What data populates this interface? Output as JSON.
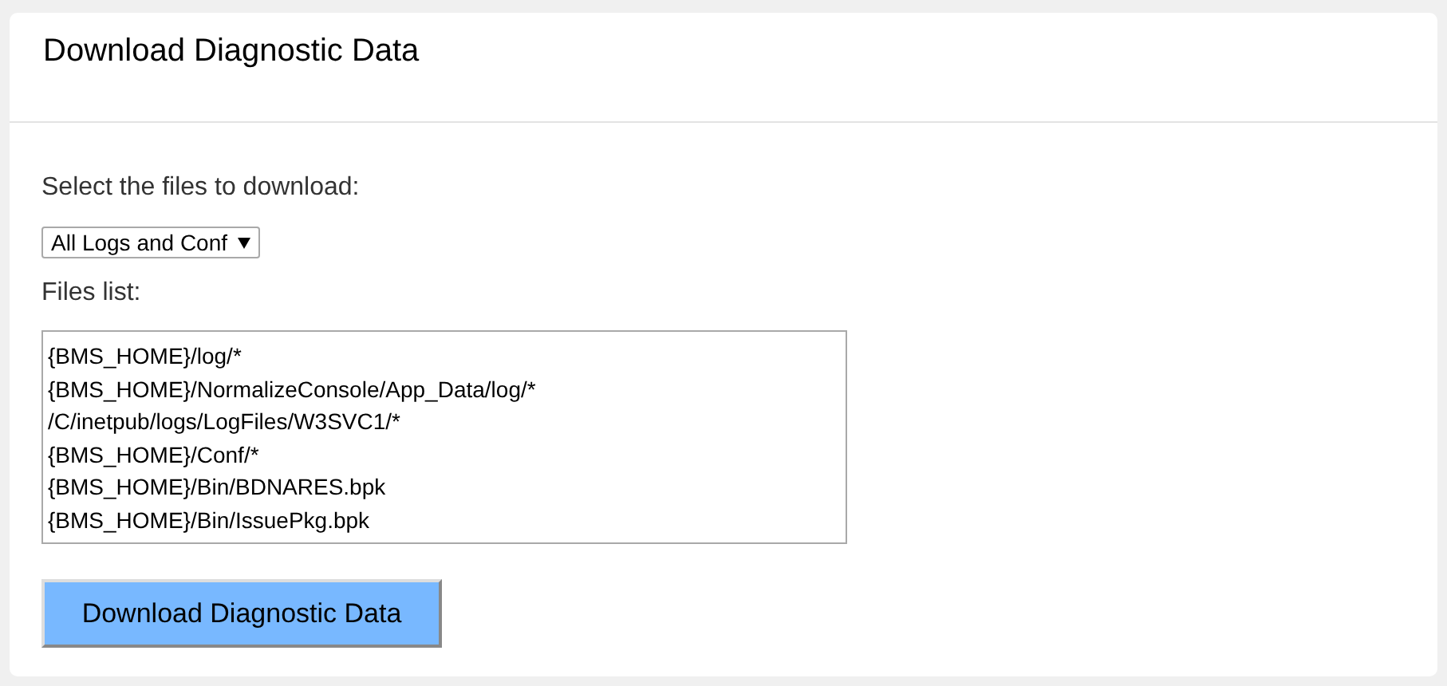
{
  "title": "Download Diagnostic Data",
  "select_label": "Select the files to download:",
  "file_set_select": {
    "value": "All Logs and Conf"
  },
  "files_label": "Files list:",
  "files_list": [
    "{BMS_HOME}/log/*",
    "{BMS_HOME}/NormalizeConsole/App_Data/log/*",
    "/C/inetpub/logs/LogFiles/W3SVC1/*",
    "{BMS_HOME}/Conf/*",
    "{BMS_HOME}/Bin/BDNARES.bpk",
    "{BMS_HOME}/Bin/IssuePkg.bpk"
  ],
  "download_button": "Download Diagnostic Data"
}
